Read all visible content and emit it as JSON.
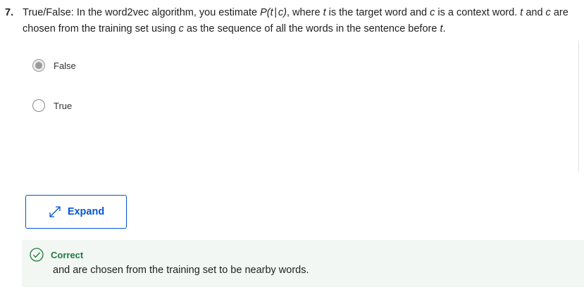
{
  "question": {
    "number": "7.",
    "segments": [
      {
        "text": "True/False: In the word2vec algorithm, you estimate ",
        "italic": false
      },
      {
        "text": "P(t∣c)",
        "italic": true
      },
      {
        "text": ", where ",
        "italic": false
      },
      {
        "text": "t",
        "italic": true
      },
      {
        "text": " is the target word and ",
        "italic": false
      },
      {
        "text": "c",
        "italic": true
      },
      {
        "text": " is a context word. ",
        "italic": false
      },
      {
        "text": "t",
        "italic": true
      },
      {
        "text": " and ",
        "italic": false
      },
      {
        "text": "c",
        "italic": true
      },
      {
        "text": " are chosen from the training set using ",
        "italic": false
      },
      {
        "text": "c",
        "italic": true
      },
      {
        "text": " as the sequence of all the words in the sentence before ",
        "italic": false
      },
      {
        "text": "t",
        "italic": true
      },
      {
        "text": ".",
        "italic": false
      }
    ]
  },
  "options": [
    {
      "label": "False",
      "selected": true
    },
    {
      "label": "True",
      "selected": false
    }
  ],
  "expand_button": {
    "label": "Expand",
    "icon": "expand-arrows-icon"
  },
  "feedback": {
    "status": "Correct",
    "text": "and  are chosen from the training set to be nearby words.",
    "icon": "check-circle-icon",
    "color": "#1f7a3e",
    "background": "#f2f7f3"
  },
  "colors": {
    "accent": "#0056d2",
    "radio_selected": "#9a9a9a"
  }
}
